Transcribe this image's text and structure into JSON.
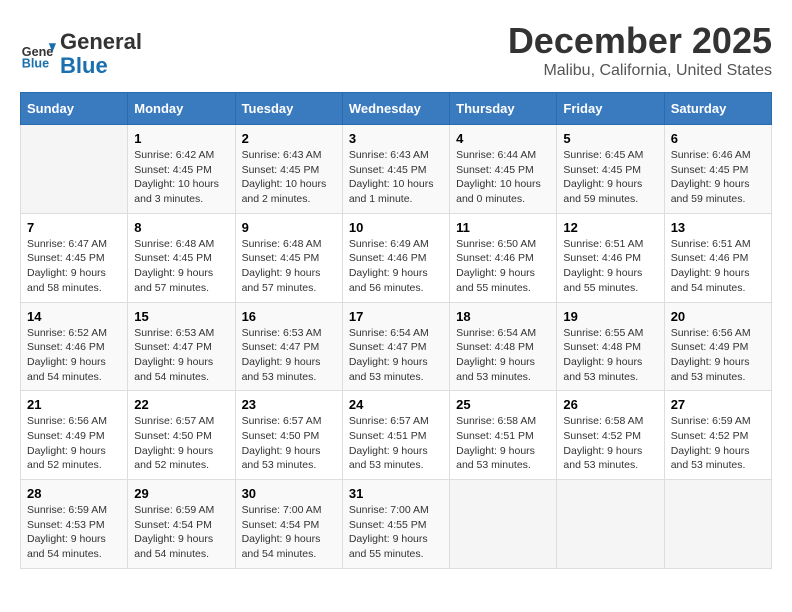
{
  "logo": {
    "general": "General",
    "blue": "Blue"
  },
  "header": {
    "title": "December 2025",
    "subtitle": "Malibu, California, United States"
  },
  "weekdays": [
    "Sunday",
    "Monday",
    "Tuesday",
    "Wednesday",
    "Thursday",
    "Friday",
    "Saturday"
  ],
  "weeks": [
    [
      {
        "day": "",
        "empty": true
      },
      {
        "day": "1",
        "sunrise": "Sunrise: 6:42 AM",
        "sunset": "Sunset: 4:45 PM",
        "daylight": "Daylight: 10 hours and 3 minutes."
      },
      {
        "day": "2",
        "sunrise": "Sunrise: 6:43 AM",
        "sunset": "Sunset: 4:45 PM",
        "daylight": "Daylight: 10 hours and 2 minutes."
      },
      {
        "day": "3",
        "sunrise": "Sunrise: 6:43 AM",
        "sunset": "Sunset: 4:45 PM",
        "daylight": "Daylight: 10 hours and 1 minute."
      },
      {
        "day": "4",
        "sunrise": "Sunrise: 6:44 AM",
        "sunset": "Sunset: 4:45 PM",
        "daylight": "Daylight: 10 hours and 0 minutes."
      },
      {
        "day": "5",
        "sunrise": "Sunrise: 6:45 AM",
        "sunset": "Sunset: 4:45 PM",
        "daylight": "Daylight: 9 hours and 59 minutes."
      },
      {
        "day": "6",
        "sunrise": "Sunrise: 6:46 AM",
        "sunset": "Sunset: 4:45 PM",
        "daylight": "Daylight: 9 hours and 59 minutes."
      }
    ],
    [
      {
        "day": "7",
        "sunrise": "Sunrise: 6:47 AM",
        "sunset": "Sunset: 4:45 PM",
        "daylight": "Daylight: 9 hours and 58 minutes."
      },
      {
        "day": "8",
        "sunrise": "Sunrise: 6:48 AM",
        "sunset": "Sunset: 4:45 PM",
        "daylight": "Daylight: 9 hours and 57 minutes."
      },
      {
        "day": "9",
        "sunrise": "Sunrise: 6:48 AM",
        "sunset": "Sunset: 4:45 PM",
        "daylight": "Daylight: 9 hours and 57 minutes."
      },
      {
        "day": "10",
        "sunrise": "Sunrise: 6:49 AM",
        "sunset": "Sunset: 4:46 PM",
        "daylight": "Daylight: 9 hours and 56 minutes."
      },
      {
        "day": "11",
        "sunrise": "Sunrise: 6:50 AM",
        "sunset": "Sunset: 4:46 PM",
        "daylight": "Daylight: 9 hours and 55 minutes."
      },
      {
        "day": "12",
        "sunrise": "Sunrise: 6:51 AM",
        "sunset": "Sunset: 4:46 PM",
        "daylight": "Daylight: 9 hours and 55 minutes."
      },
      {
        "day": "13",
        "sunrise": "Sunrise: 6:51 AM",
        "sunset": "Sunset: 4:46 PM",
        "daylight": "Daylight: 9 hours and 54 minutes."
      }
    ],
    [
      {
        "day": "14",
        "sunrise": "Sunrise: 6:52 AM",
        "sunset": "Sunset: 4:46 PM",
        "daylight": "Daylight: 9 hours and 54 minutes."
      },
      {
        "day": "15",
        "sunrise": "Sunrise: 6:53 AM",
        "sunset": "Sunset: 4:47 PM",
        "daylight": "Daylight: 9 hours and 54 minutes."
      },
      {
        "day": "16",
        "sunrise": "Sunrise: 6:53 AM",
        "sunset": "Sunset: 4:47 PM",
        "daylight": "Daylight: 9 hours and 53 minutes."
      },
      {
        "day": "17",
        "sunrise": "Sunrise: 6:54 AM",
        "sunset": "Sunset: 4:47 PM",
        "daylight": "Daylight: 9 hours and 53 minutes."
      },
      {
        "day": "18",
        "sunrise": "Sunrise: 6:54 AM",
        "sunset": "Sunset: 4:48 PM",
        "daylight": "Daylight: 9 hours and 53 minutes."
      },
      {
        "day": "19",
        "sunrise": "Sunrise: 6:55 AM",
        "sunset": "Sunset: 4:48 PM",
        "daylight": "Daylight: 9 hours and 53 minutes."
      },
      {
        "day": "20",
        "sunrise": "Sunrise: 6:56 AM",
        "sunset": "Sunset: 4:49 PM",
        "daylight": "Daylight: 9 hours and 53 minutes."
      }
    ],
    [
      {
        "day": "21",
        "sunrise": "Sunrise: 6:56 AM",
        "sunset": "Sunset: 4:49 PM",
        "daylight": "Daylight: 9 hours and 52 minutes."
      },
      {
        "day": "22",
        "sunrise": "Sunrise: 6:57 AM",
        "sunset": "Sunset: 4:50 PM",
        "daylight": "Daylight: 9 hours and 52 minutes."
      },
      {
        "day": "23",
        "sunrise": "Sunrise: 6:57 AM",
        "sunset": "Sunset: 4:50 PM",
        "daylight": "Daylight: 9 hours and 53 minutes."
      },
      {
        "day": "24",
        "sunrise": "Sunrise: 6:57 AM",
        "sunset": "Sunset: 4:51 PM",
        "daylight": "Daylight: 9 hours and 53 minutes."
      },
      {
        "day": "25",
        "sunrise": "Sunrise: 6:58 AM",
        "sunset": "Sunset: 4:51 PM",
        "daylight": "Daylight: 9 hours and 53 minutes."
      },
      {
        "day": "26",
        "sunrise": "Sunrise: 6:58 AM",
        "sunset": "Sunset: 4:52 PM",
        "daylight": "Daylight: 9 hours and 53 minutes."
      },
      {
        "day": "27",
        "sunrise": "Sunrise: 6:59 AM",
        "sunset": "Sunset: 4:52 PM",
        "daylight": "Daylight: 9 hours and 53 minutes."
      }
    ],
    [
      {
        "day": "28",
        "sunrise": "Sunrise: 6:59 AM",
        "sunset": "Sunset: 4:53 PM",
        "daylight": "Daylight: 9 hours and 54 minutes."
      },
      {
        "day": "29",
        "sunrise": "Sunrise: 6:59 AM",
        "sunset": "Sunset: 4:54 PM",
        "daylight": "Daylight: 9 hours and 54 minutes."
      },
      {
        "day": "30",
        "sunrise": "Sunrise: 7:00 AM",
        "sunset": "Sunset: 4:54 PM",
        "daylight": "Daylight: 9 hours and 54 minutes."
      },
      {
        "day": "31",
        "sunrise": "Sunrise: 7:00 AM",
        "sunset": "Sunset: 4:55 PM",
        "daylight": "Daylight: 9 hours and 55 minutes."
      },
      {
        "day": "",
        "empty": true
      },
      {
        "day": "",
        "empty": true
      },
      {
        "day": "",
        "empty": true
      }
    ]
  ]
}
